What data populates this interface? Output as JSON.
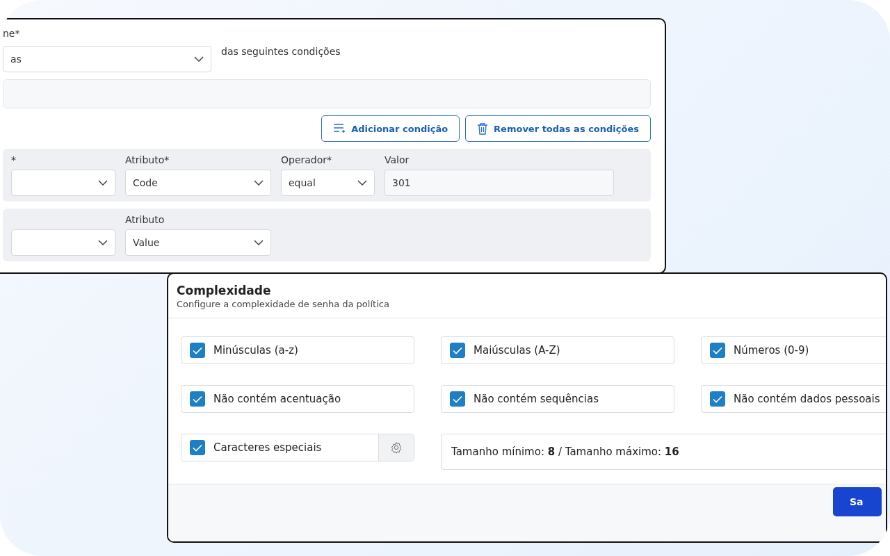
{
  "rule_form": {
    "match_label": "ne*",
    "match_select": "as",
    "match_suffix": "das seguintes condições",
    "buttons": [
      {
        "kind": "add",
        "label": "Adicionar condição"
      },
      {
        "kind": "remove",
        "label": "Remover todas as condições"
      }
    ],
    "conditions": [
      {
        "fields": [
          {
            "label": "*"
          },
          {
            "label": "Atributo*",
            "value": "Code"
          },
          {
            "label": "Operador*",
            "value": "equal"
          },
          {
            "label": "Valor",
            "value": "301",
            "kind": "text"
          }
        ]
      },
      {
        "fields": [
          {
            "kind": "select"
          },
          {
            "label": "Atributo",
            "value": "Value"
          }
        ]
      }
    ]
  },
  "complexity": {
    "title": "Complexidade",
    "subtitle": "Configure a complexidade de senha da política",
    "options": [
      {
        "label": "Minúsculas (a-z)",
        "checked": true
      },
      {
        "label": "Maiúsculas (A-Z)",
        "checked": true
      },
      {
        "label": "Números (0-9)",
        "checked": true
      },
      {
        "label": "Não contém acentuação",
        "checked": true
      },
      {
        "label": "Não contém sequências",
        "checked": true
      },
      {
        "label": "Não contém dados pessoais",
        "checked": true
      },
      {
        "label": "Caracteres especiais",
        "checked": true,
        "kind": "settings"
      }
    ],
    "length": "Tamanho mínimo: **8** / Tamanho máximo: **16**",
    "save_button": "Sa"
  }
}
